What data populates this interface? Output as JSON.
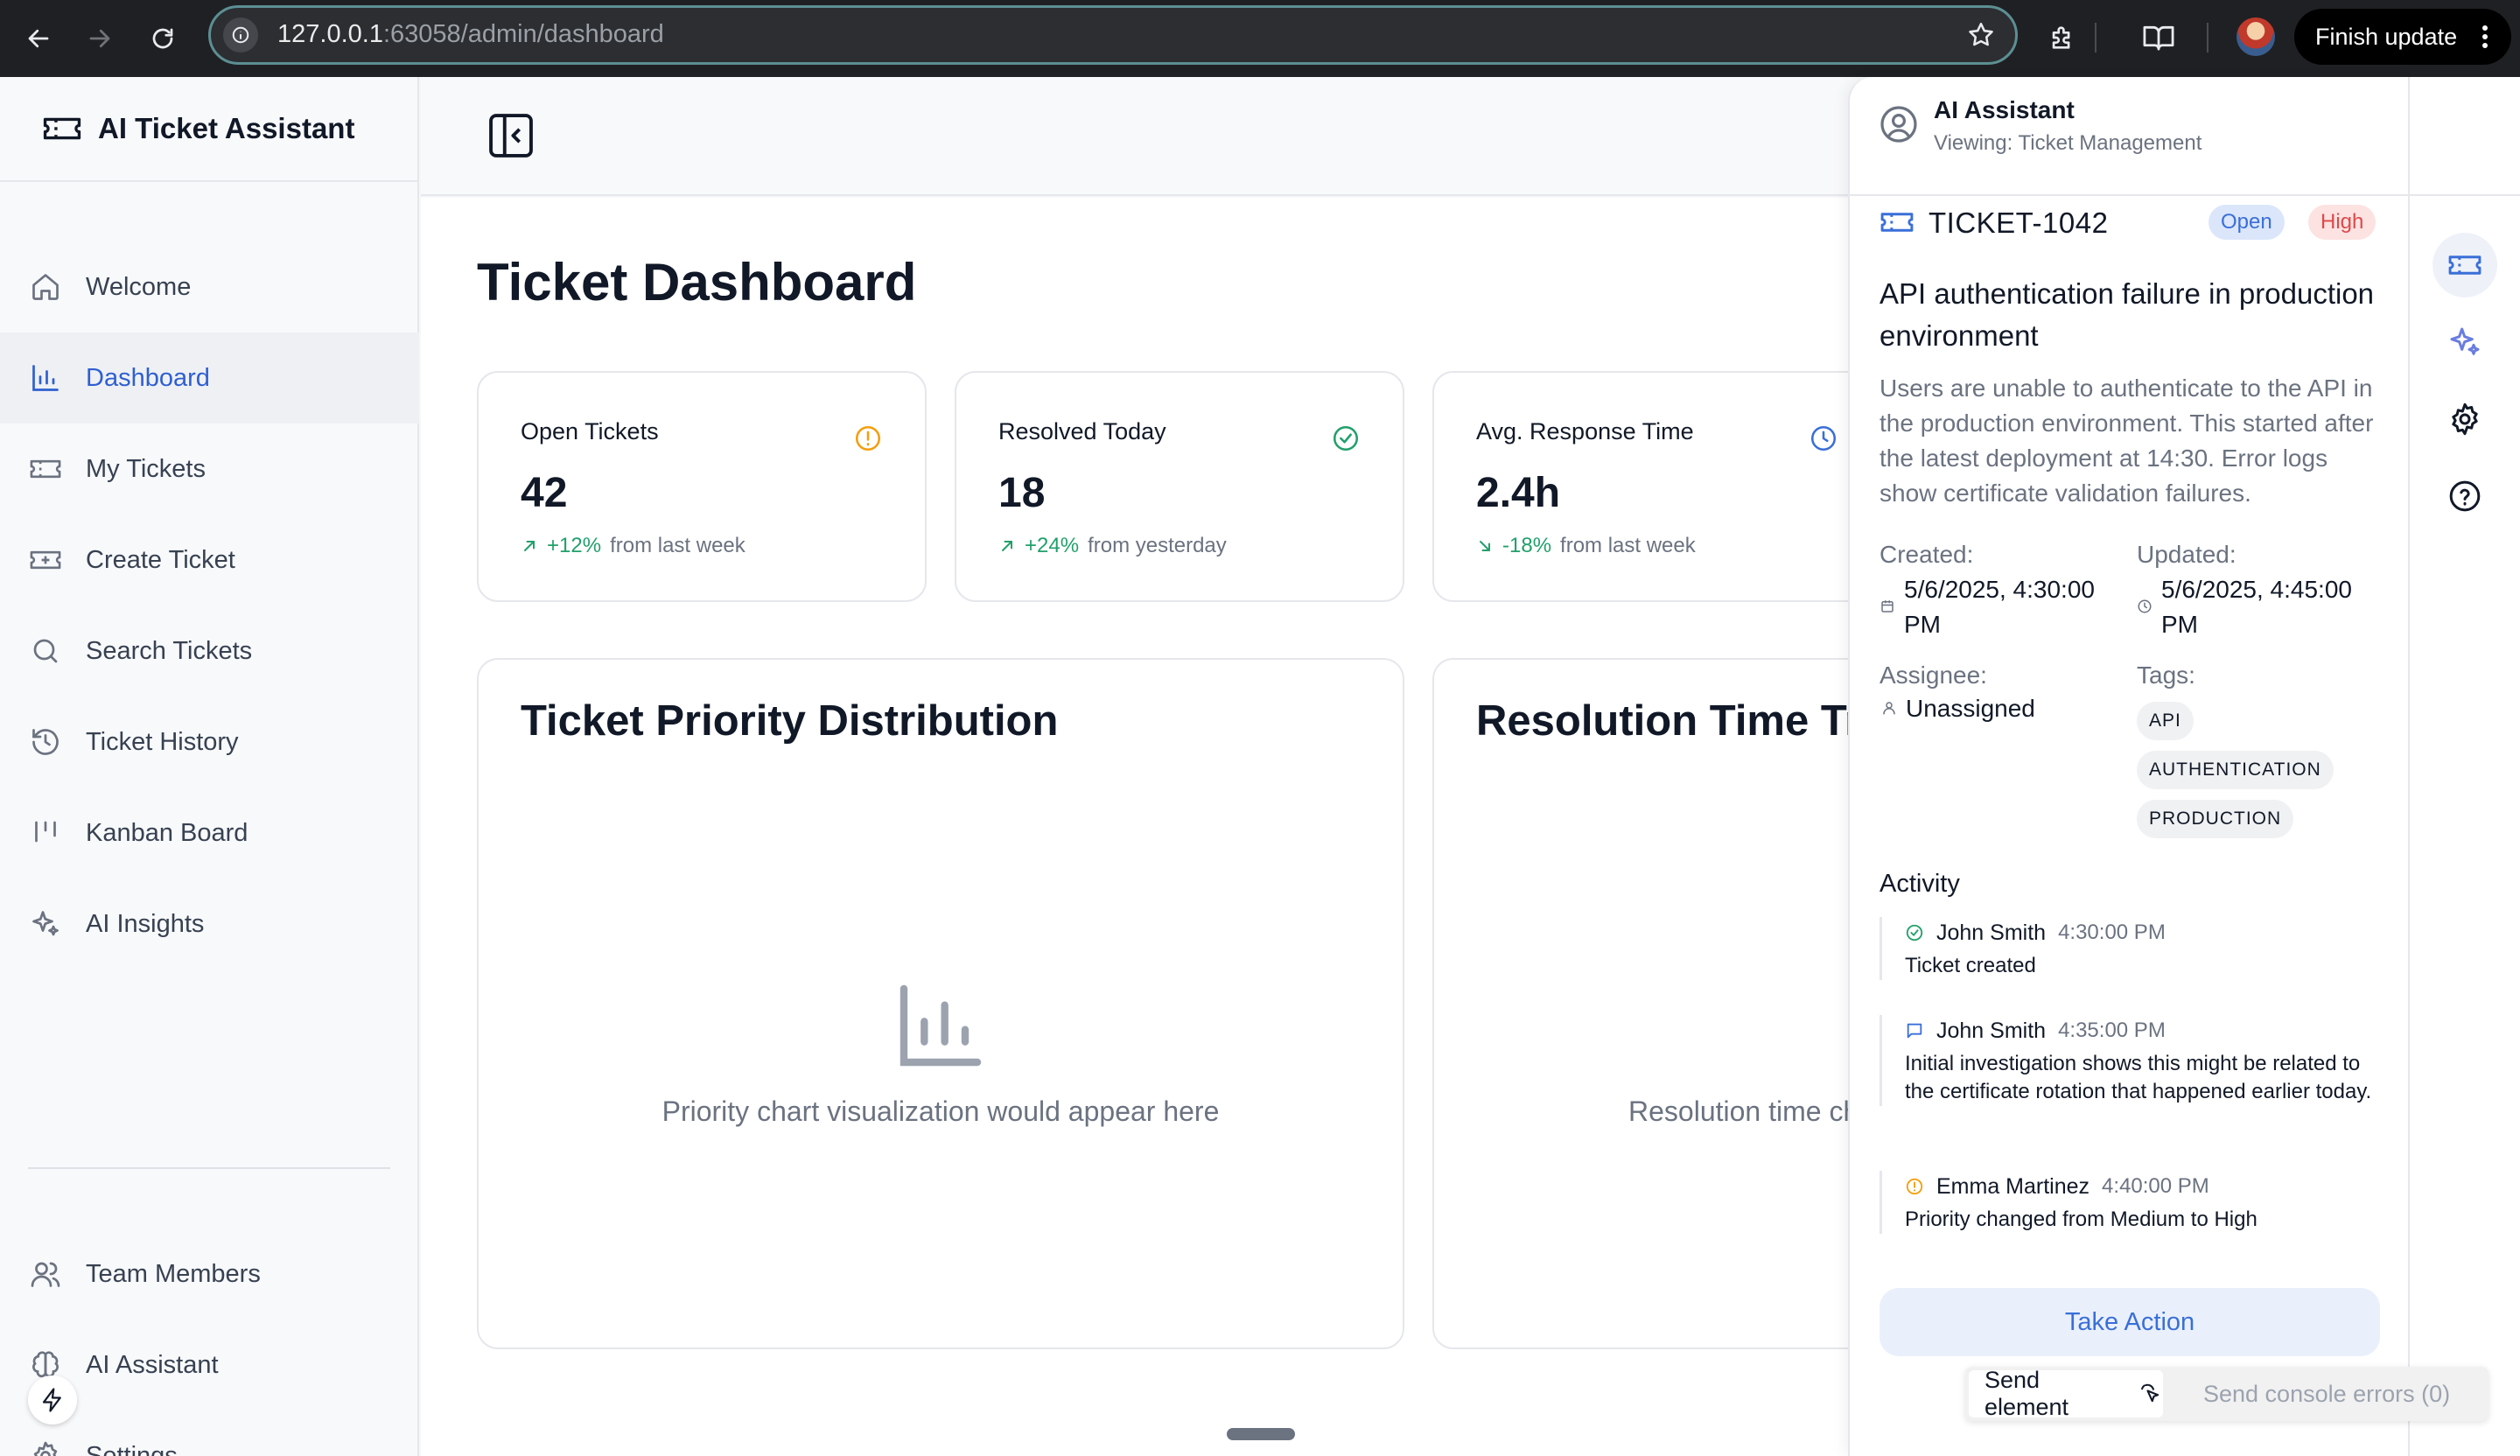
{
  "browser": {
    "url_host": "127.0.0.1",
    "url_rest": ":63058/admin/dashboard",
    "finish_update": "Finish update"
  },
  "app": {
    "title": "AI Ticket Assistant"
  },
  "sidebar": {
    "items": [
      {
        "label": "Welcome",
        "icon": "home-icon"
      },
      {
        "label": "Dashboard",
        "icon": "bar-chart-icon",
        "active": true
      },
      {
        "label": "My Tickets",
        "icon": "ticket-icon"
      },
      {
        "label": "Create Ticket",
        "icon": "ticket-plus-icon"
      },
      {
        "label": "Search Tickets",
        "icon": "search-icon"
      },
      {
        "label": "Ticket History",
        "icon": "history-icon"
      },
      {
        "label": "Kanban Board",
        "icon": "kanban-icon"
      },
      {
        "label": "AI Insights",
        "icon": "sparkles-icon"
      }
    ],
    "bottom_items": [
      {
        "label": "Team Members",
        "icon": "users-icon"
      },
      {
        "label": "AI Assistant",
        "icon": "brain-icon"
      },
      {
        "label": "Settings",
        "icon": "settings-icon"
      }
    ]
  },
  "main": {
    "title": "Ticket Dashboard",
    "stats": [
      {
        "label": "Open Tickets",
        "value": "42",
        "change": "+12%",
        "period": "from last week",
        "trend": "up",
        "icon": "alert-circle-icon",
        "color": "#f59e0b"
      },
      {
        "label": "Resolved Today",
        "value": "18",
        "change": "+24%",
        "period": "from yesterday",
        "trend": "up",
        "icon": "check-circle-icon",
        "color": "#22a06b"
      },
      {
        "label": "Avg. Response Time",
        "value": "2.4h",
        "change": "-18%",
        "period": "from last week",
        "trend": "down",
        "icon": "clock-icon",
        "color": "#3a6fd8"
      }
    ],
    "charts": [
      {
        "title": "Ticket Priority Distribution",
        "placeholder": "Priority chart visualization would appear here"
      },
      {
        "title": "Resolution Time Trends",
        "placeholder": "Resolution time chart visualization would appear here"
      }
    ]
  },
  "assistant": {
    "title": "AI Assistant",
    "subtitle": "Viewing: Ticket Management",
    "ticket": {
      "id": "TICKET-1042",
      "status": "Open",
      "priority": "High",
      "title": "API authentication failure in production environment",
      "description": "Users are unable to authenticate to the API in the production environment. This started after the latest deployment at 14:30. Error logs show certificate validation failures.",
      "created_label": "Created:",
      "created": "5/6/2025, 4:30:00 PM",
      "updated_label": "Updated:",
      "updated": "5/6/2025, 4:45:00 PM",
      "assignee_label": "Assignee:",
      "assignee": "Unassigned",
      "tags_label": "Tags:",
      "tags": [
        "API",
        "AUTHENTICATION",
        "PRODUCTION"
      ]
    },
    "activity_label": "Activity",
    "activity": [
      {
        "user": "John Smith",
        "time": "4:30:00 PM",
        "text": "Ticket created",
        "icon": "check-circle-icon",
        "color": "#22a06b"
      },
      {
        "user": "John Smith",
        "time": "4:35:00 PM",
        "text": "Initial investigation shows this might be related to the certificate rotation that happened earlier today.",
        "icon": "message-icon",
        "color": "#3a6fd8"
      },
      {
        "user": "Emma Martinez",
        "time": "4:40:00 PM",
        "text": "Priority changed from Medium to High",
        "icon": "alert-circle-icon",
        "color": "#f59e0b"
      }
    ],
    "take_action": "Take Action"
  },
  "toolbar": {
    "send_element": "Send element",
    "send_console": "Send console errors (0)"
  }
}
